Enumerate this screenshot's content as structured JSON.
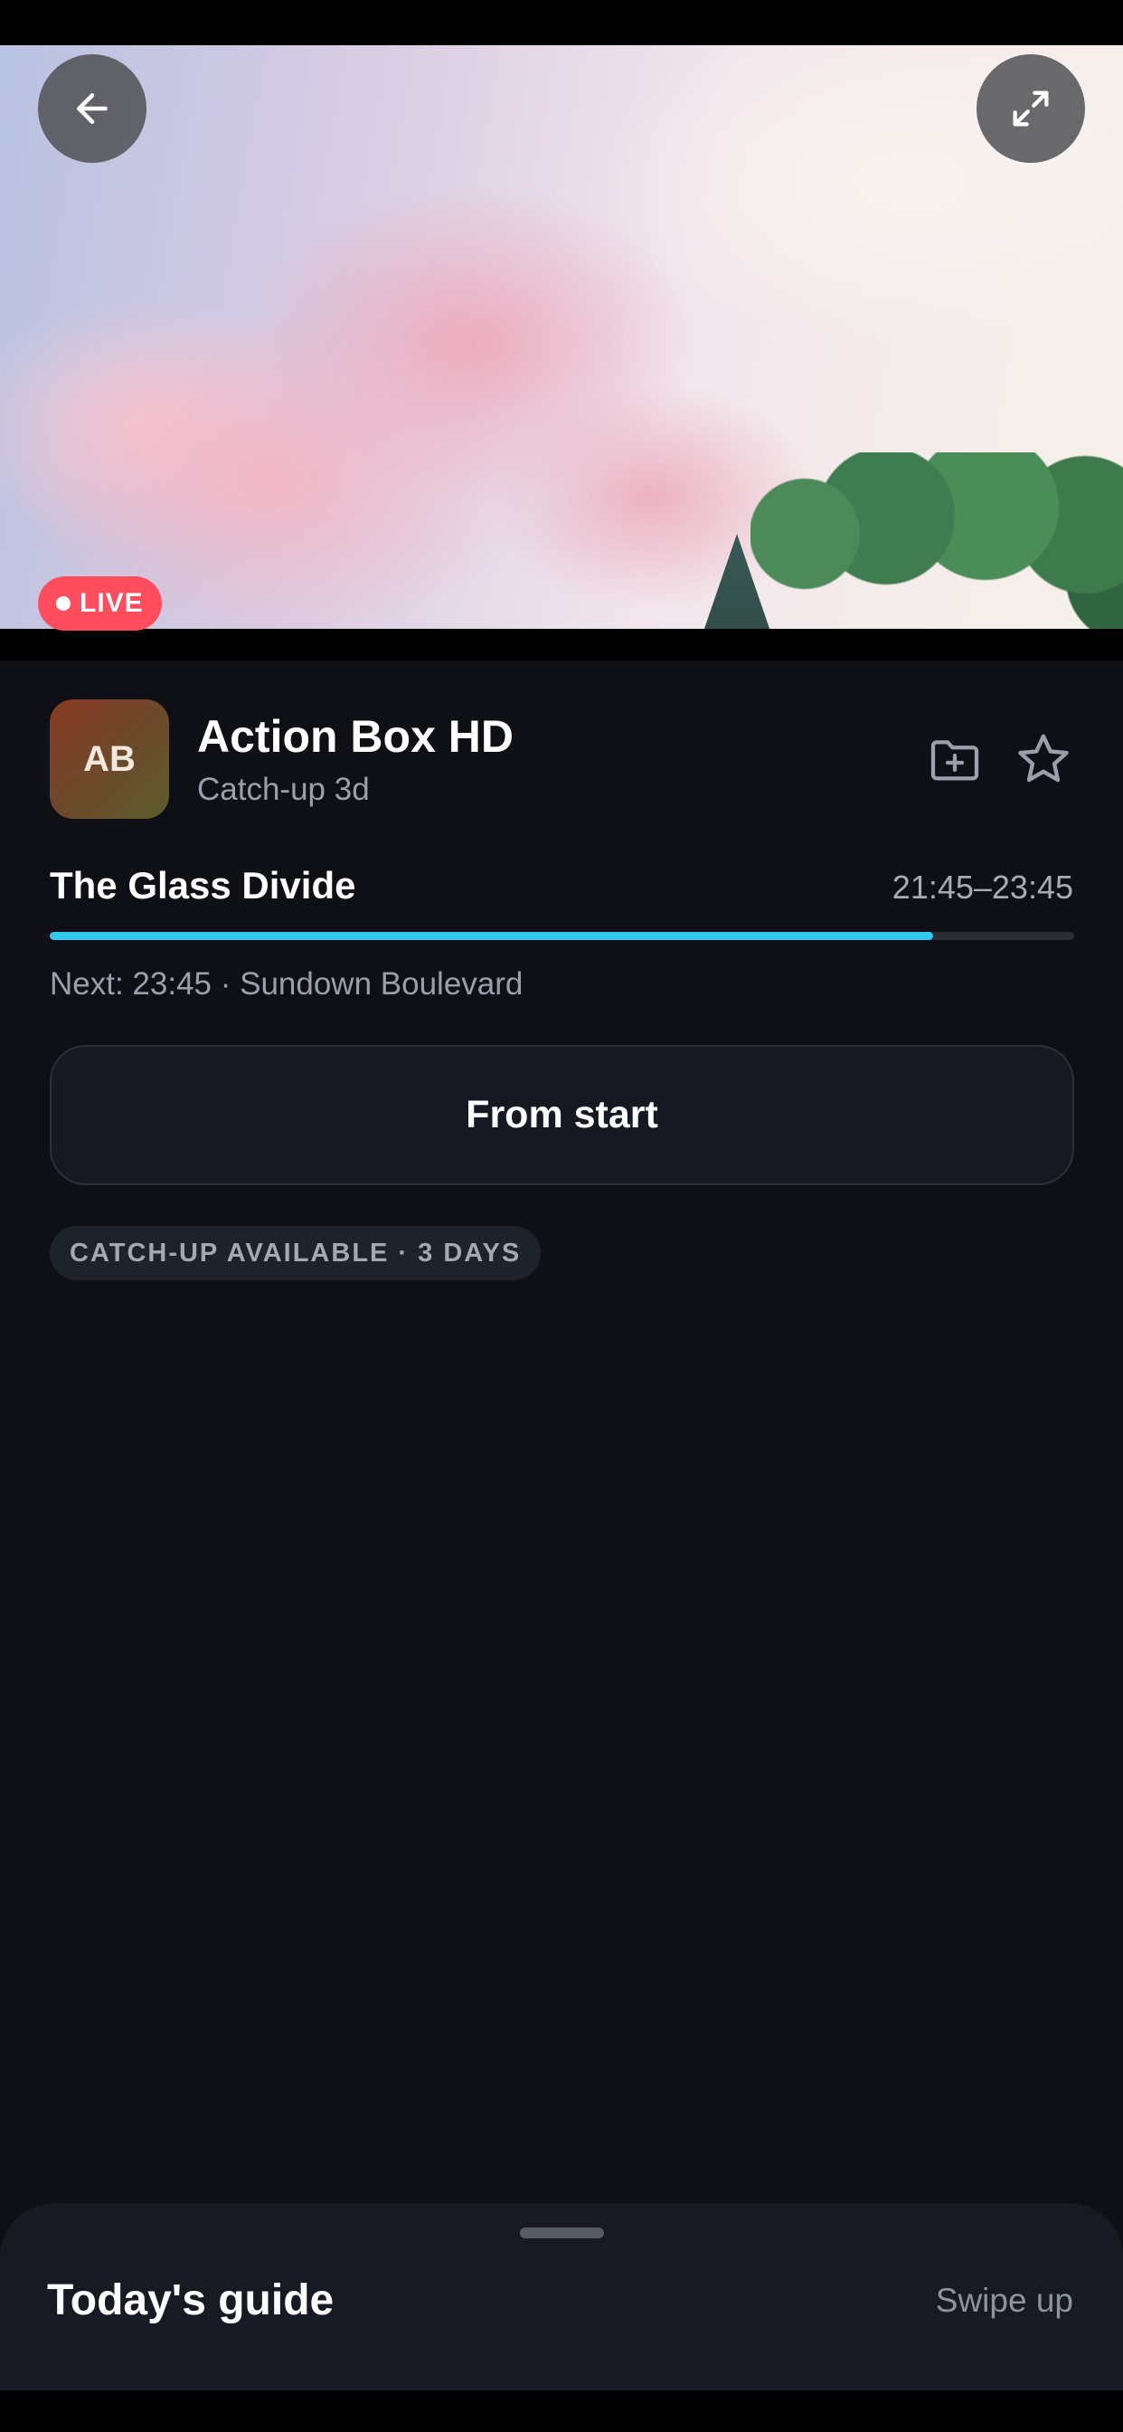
{
  "player": {
    "live_label": "LIVE",
    "back_icon": "arrow-left-icon",
    "fullscreen_icon": "expand-icon"
  },
  "channel": {
    "logo_text": "AB",
    "name": "Action Box HD",
    "subtitle": "Catch-up 3d",
    "actions": [
      "folder-add-icon",
      "star-icon"
    ]
  },
  "program": {
    "title": "The Glass Divide",
    "time_range": "21:45–23:45",
    "progress": 0.862,
    "next": "Next: 23:45 · Sundown Boulevard"
  },
  "from_start_label": "From start",
  "catchup_chip": "CATCH-UP AVAILABLE · 3 DAYS",
  "guide": {
    "title": "Today's guide",
    "hint": "Swipe up"
  },
  "colors": {
    "live": "#ff4d5e",
    "progress": "#33c8ee",
    "background": "#0f1015"
  }
}
